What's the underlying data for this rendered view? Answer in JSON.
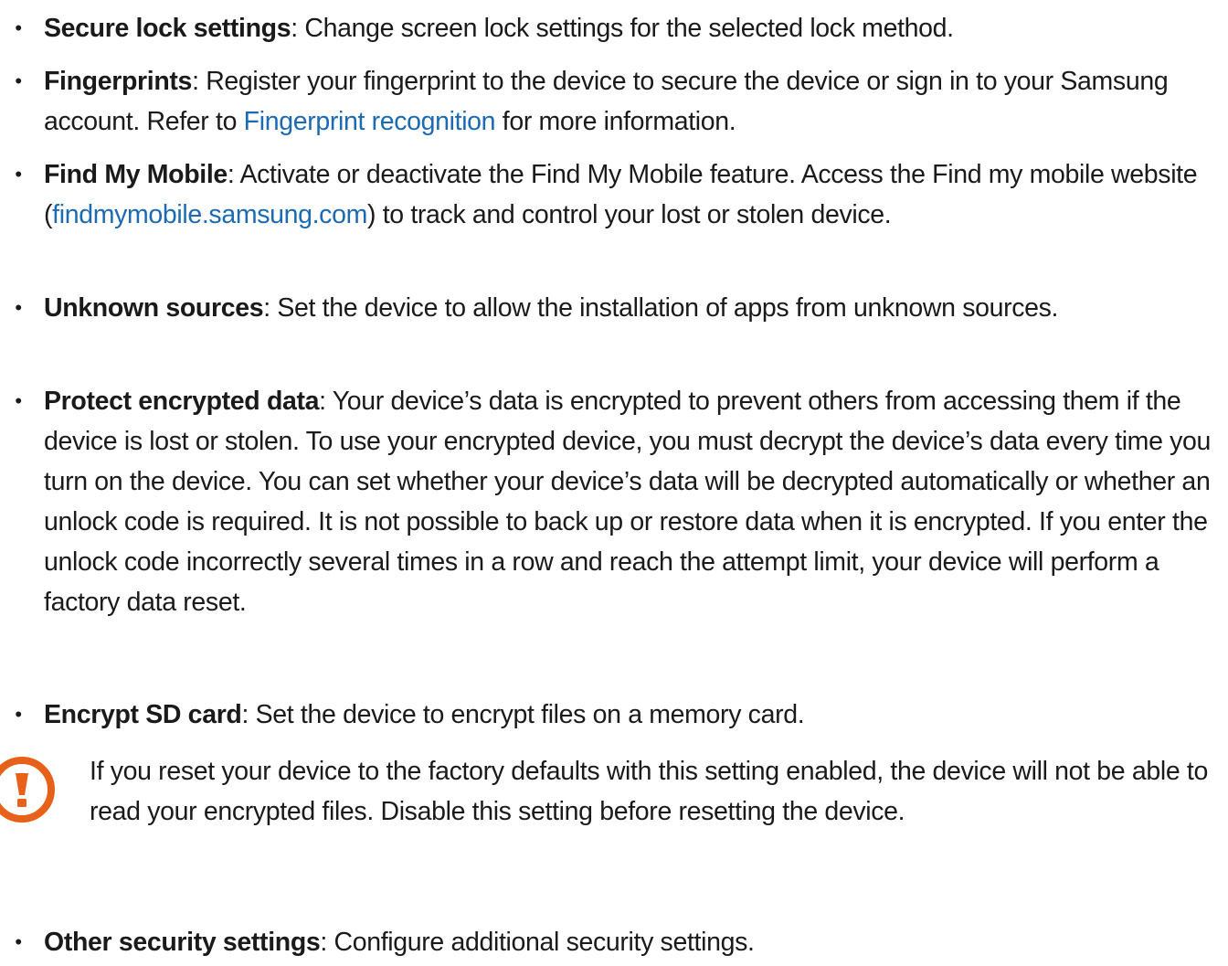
{
  "items": [
    {
      "term": "Secure lock settings",
      "text": ": Change screen lock settings for the selected lock method."
    },
    {
      "term": "Fingerprints",
      "text_before": ": Register your fingerprint to the device to secure the device or sign in to your Samsung account. Refer to ",
      "link": "Fingerprint recognition",
      "text_after": " for more information."
    },
    {
      "term": "Find My Mobile",
      "text_before": ": Activate or deactivate the Find My Mobile feature. Access the Find my mobile website (",
      "link": "findmymobile.samsung.com",
      "text_after": ") to track and control your lost or stolen device."
    },
    {
      "term": "Unknown sources",
      "text": ": Set the device to allow the installation of apps from unknown sources."
    },
    {
      "term": "Protect encrypted data",
      "text": ": Your device’s data is encrypted to prevent others from accessing them if the device is lost or stolen. To use your encrypted device, you must decrypt the device’s data every time you turn on the device. You can set whether your device’s data will be decrypted automatically or whether an unlock code is required. It is not possible to back up or restore data when it is encrypted. If you enter the unlock code incorrectly several times in a row and reach the attempt limit, your device will perform a factory data reset."
    },
    {
      "term": "Encrypt SD card",
      "text": ": Set the device to encrypt files on a memory card."
    },
    {
      "term": "Other security settings",
      "text": ": Configure additional security settings."
    }
  ],
  "caution": {
    "icon": "caution-icon",
    "text": "If you reset your device to the factory defaults with this setting enabled, the device will not be able to read your encrypted files. Disable this setting before resetting the device."
  },
  "bullet_symbol": "•",
  "colors": {
    "text": "#1a1a1a",
    "link": "#1b6ab3",
    "caution": "#e8611a"
  }
}
